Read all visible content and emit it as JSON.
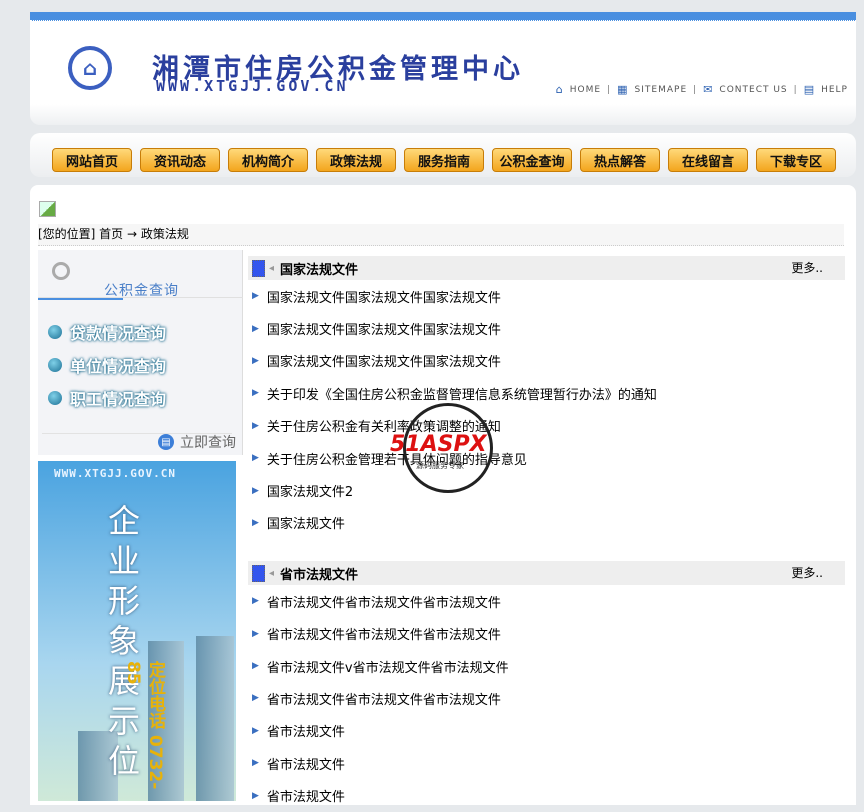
{
  "header": {
    "title": "湘潭市住房公积金管理中心",
    "domain": "WWW.XTGJJ.GOV.CN",
    "links": [
      "HOME",
      "SITEMAPE",
      "CONTECT US",
      "HELP"
    ]
  },
  "nav": [
    "网站首页",
    "资讯动态",
    "机构简介",
    "政策法规",
    "服务指南",
    "公积金查询",
    "热点解答",
    "在线留言",
    "下载专区"
  ],
  "breadcrumb": "[您的位置] 首页 → 政策法规",
  "query": {
    "title": "公积金查询",
    "items": [
      "贷款情况查询",
      "单位情况查询",
      "职工情况查询"
    ],
    "button": "立即查询"
  },
  "banner": {
    "domain": "WWW.XTGJJ.GOV.CN",
    "text": "企业形象展示位",
    "phone": "定位电话 0732-85"
  },
  "sections": [
    {
      "title": "国家法规文件",
      "more": "更多..",
      "items": [
        "国家法规文件国家法规文件国家法规文件",
        "国家法规文件国家法规文件国家法规文件",
        "国家法规文件国家法规文件国家法规文件",
        "关于印发《全国住房公积金监督管理信息系统管理暂行办法》的通知",
        "关于住房公积金有关利率政策调整的通知",
        "关于住房公积金管理若干具体问题的指导意见",
        "国家法规文件2",
        "国家法规文件"
      ]
    },
    {
      "title": "省市法规文件",
      "more": "更多..",
      "items": [
        "省市法规文件省市法规文件省市法规文件",
        "省市法规文件省市法规文件省市法规文件",
        "省市法规文件v省市法规文件省市法规文件",
        "省市法规文件省市法规文件省市法规文件",
        "省市法规文件",
        "省市法规文件",
        "省市法规文件"
      ]
    }
  ],
  "watermark": {
    "brand": "51ASPX",
    "slogan": "源码服务专家"
  }
}
